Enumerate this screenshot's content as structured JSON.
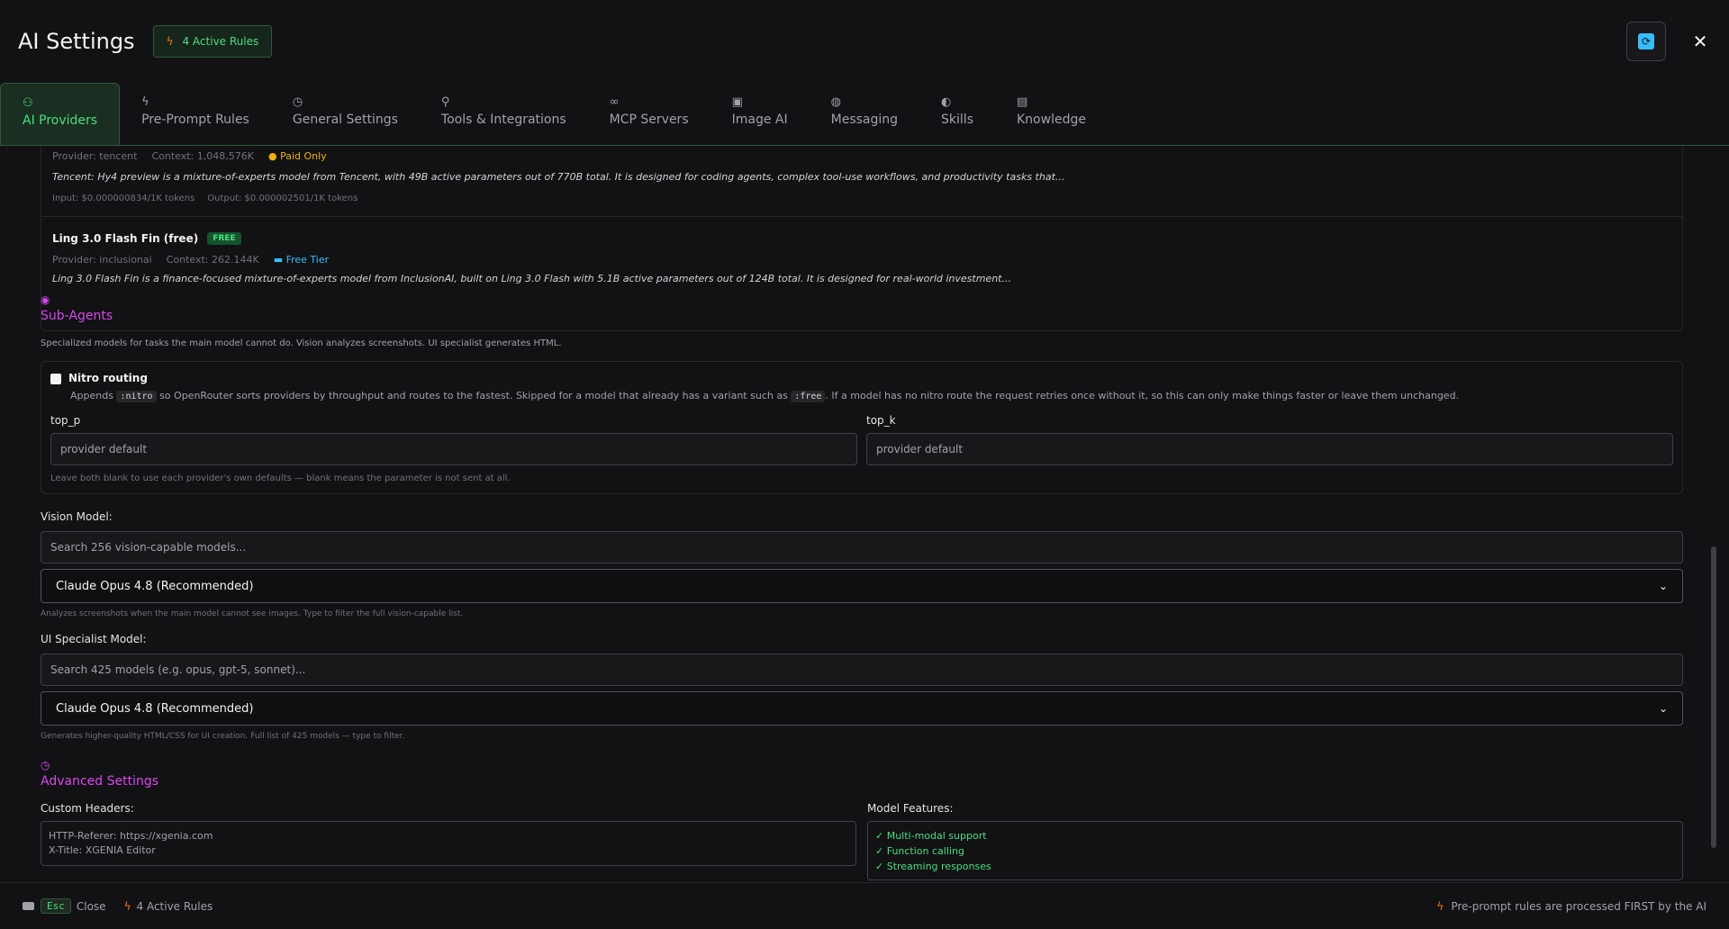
{
  "header": {
    "title": "AI Settings",
    "active_rules_badge": "4 Active Rules"
  },
  "tabs": [
    {
      "label": "AI Providers",
      "icon": "user-icon",
      "active": true
    },
    {
      "label": "Pre-Prompt Rules",
      "icon": "bolt-icon"
    },
    {
      "label": "General Settings",
      "icon": "clock-icon"
    },
    {
      "label": "Tools & Integrations",
      "icon": "wrench-icon"
    },
    {
      "label": "MCP Servers",
      "icon": "link-icon"
    },
    {
      "label": "Image AI",
      "icon": "image-icon"
    },
    {
      "label": "Messaging",
      "icon": "chat-icon"
    },
    {
      "label": "Skills",
      "icon": "brain-icon"
    },
    {
      "label": "Knowledge",
      "icon": "database-icon"
    }
  ],
  "models": [
    {
      "provider": "Provider: tencent",
      "context": "Context: 1,048,576K",
      "tier": "Paid Only",
      "description": "Tencent: Hy4 preview is a mixture-of-experts model from Tencent, with 49B active parameters out of 770B total. It is designed for coding agents, complex tool-use workflows, and productivity tasks that...",
      "input_price": "Input: $0.000000834/1K tokens",
      "output_price": "Output: $0.000002501/1K tokens"
    },
    {
      "name": "Ling 3.0 Flash Fin (free)",
      "free_chip": "FREE",
      "provider": "Provider: inclusionai",
      "context": "Context: 262.144K",
      "tier": "Free Tier",
      "description": "Ling 3.0 Flash Fin is a finance-focused mixture-of-experts model from InclusionAI, built on Ling 3.0 Flash with 5.1B active parameters out of 124B total. It is designed for real-world investment..."
    }
  ],
  "sub_agents": {
    "title": "Sub-Agents",
    "description": "Specialized models for tasks the main model cannot do. Vision analyzes screenshots. UI specialist generates HTML.",
    "nitro": {
      "label": "Nitro routing",
      "desc_1": "Appends",
      "code_1": ":nitro",
      "desc_2": "so OpenRouter sorts providers by throughput and routes to the fastest. Skipped for a model that already has a variant such as",
      "code_2": ":free",
      "desc_3": ". If a model has no nitro route the request retries once without it, so this can only make things faster or leave them unchanged."
    },
    "top_p": {
      "label": "top_p",
      "placeholder": "provider default"
    },
    "top_k": {
      "label": "top_k",
      "placeholder": "provider default"
    },
    "sampling_hint": "Leave both blank to use each provider's own defaults — blank means the parameter is not sent at all.",
    "vision": {
      "label": "Vision Model:",
      "search_placeholder": "Search 256 vision-capable models...",
      "selected": "Claude Opus 4.8 (Recommended)",
      "hint": "Analyzes screenshots when the main model cannot see images. Type to filter the full vision-capable list."
    },
    "ui_specialist": {
      "label": "UI Specialist Model:",
      "search_placeholder": "Search 425 models (e.g. opus, gpt-5, sonnet)...",
      "selected": "Claude Opus 4.8 (Recommended)",
      "hint": "Generates higher-quality HTML/CSS for UI creation. Full list of 425 models — type to filter."
    }
  },
  "advanced": {
    "title": "Advanced Settings",
    "custom_headers_label": "Custom Headers:",
    "custom_headers_line1": "HTTP-Referer: https://xgenia.com",
    "custom_headers_line2": "X-Title: XGENIA Editor",
    "model_features_label": "Model Features:",
    "features": [
      "✓ Multi-modal support",
      "✓ Function calling",
      "✓ Streaming responses"
    ]
  },
  "footer": {
    "esc_key": "Esc",
    "close_label": "Close",
    "active_rules": "4 Active Rules",
    "right_text": "Pre-prompt rules are processed FIRST by the AI"
  },
  "colors": {
    "accent_green": "#4ade80",
    "section_magenta": "#d946ef",
    "paid_yellow": "#eab308",
    "free_blue": "#38bdf8",
    "bolt_orange": "#f97316"
  }
}
